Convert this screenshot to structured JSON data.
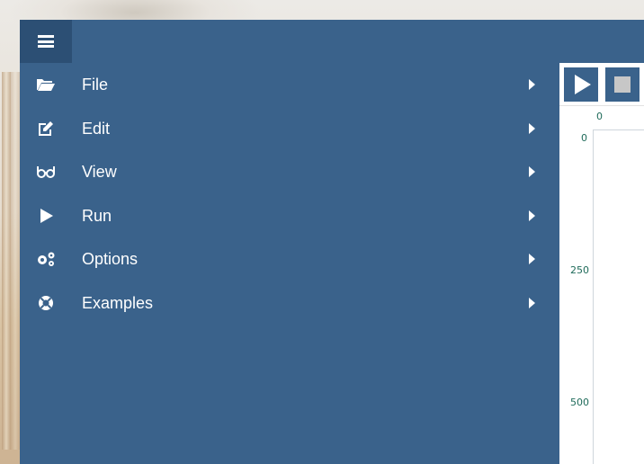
{
  "menu": {
    "toggle_icon": "hamburger-icon",
    "items": [
      {
        "label": "File",
        "icon": "folder-open-icon"
      },
      {
        "label": "Edit",
        "icon": "edit-icon"
      },
      {
        "label": "View",
        "icon": "glasses-icon"
      },
      {
        "label": "Run",
        "icon": "play-icon"
      },
      {
        "label": "Options",
        "icon": "gears-icon"
      },
      {
        "label": "Examples",
        "icon": "lifebuoy-icon"
      }
    ]
  },
  "toolbar": {
    "play_icon": "play-icon",
    "stop_icon": "stop-icon"
  },
  "canvas": {
    "x_tick_0": "0",
    "y_ticks": [
      "0",
      "250",
      "500"
    ]
  },
  "colors": {
    "panel": "#3a628b",
    "panel_dark": "#2c4f74",
    "tick_text": "#1f6b5a"
  }
}
